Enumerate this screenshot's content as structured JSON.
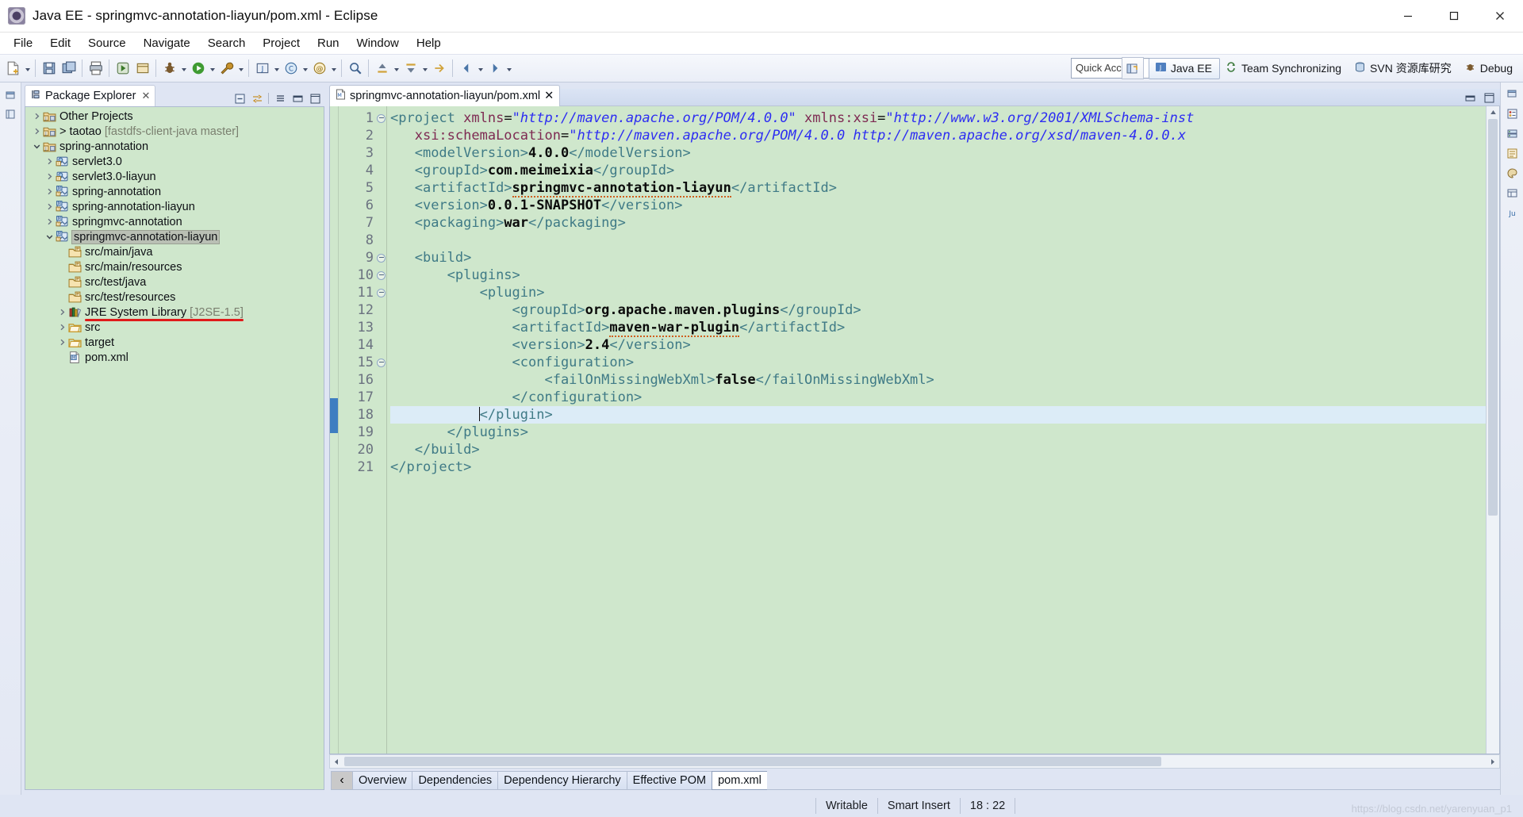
{
  "window": {
    "title": "Java EE - springmvc-annotation-liayun/pom.xml - Eclipse",
    "app_icon": "eclipse-icon",
    "minimize_label": "Minimize",
    "maximize_label": "Maximize",
    "close_label": "Close"
  },
  "menubar": {
    "items": [
      {
        "label": "File"
      },
      {
        "label": "Edit"
      },
      {
        "label": "Source"
      },
      {
        "label": "Navigate"
      },
      {
        "label": "Search"
      },
      {
        "label": "Project"
      },
      {
        "label": "Run"
      },
      {
        "label": "Window"
      },
      {
        "label": "Help"
      }
    ]
  },
  "toolbar": {
    "quick_access_placeholder": "Quick Access",
    "quick_access_value": "",
    "open_perspective_label": "Open Perspective",
    "perspectives": [
      {
        "label": "Java EE",
        "active": true,
        "icon": "java-ee-perspective-icon"
      },
      {
        "label": "Team Synchronizing",
        "active": false,
        "icon": "team-sync-icon"
      },
      {
        "label": "SVN 资源库研究",
        "active": false,
        "icon": "svn-repo-icon"
      },
      {
        "label": "Debug",
        "active": false,
        "icon": "debug-perspective-icon"
      }
    ]
  },
  "explorer": {
    "tab_label": "Package Explorer",
    "tab_close": "✕",
    "tools": [
      {
        "name": "collapse-all-icon"
      },
      {
        "name": "link-with-editor-icon"
      },
      {
        "name": "view-menu-icon"
      },
      {
        "name": "minimize-view-icon"
      },
      {
        "name": "maximize-view-icon"
      }
    ],
    "tree": [
      {
        "indent": 0,
        "twisty": "collapsed",
        "icon": "project-folder-icon",
        "label": "Other Projects",
        "suffix": "",
        "selected": false,
        "underline": false
      },
      {
        "indent": 0,
        "twisty": "collapsed",
        "icon": "project-folder-icon",
        "label": "> taotao",
        "suffix": "[fastdfs-client-java master]",
        "selected": false,
        "underline": false
      },
      {
        "indent": 0,
        "twisty": "expanded",
        "icon": "project-folder-icon",
        "label": "spring-annotation",
        "suffix": "",
        "selected": false,
        "underline": false
      },
      {
        "indent": 1,
        "twisty": "collapsed",
        "icon": "web-project-icon",
        "label": "servlet3.0",
        "suffix": "",
        "selected": false,
        "underline": false
      },
      {
        "indent": 1,
        "twisty": "collapsed",
        "icon": "web-project-icon",
        "label": "servlet3.0-liayun",
        "suffix": "",
        "selected": false,
        "underline": false
      },
      {
        "indent": 1,
        "twisty": "collapsed",
        "icon": "maven-project-icon",
        "label": "spring-annotation",
        "suffix": "",
        "selected": false,
        "underline": false
      },
      {
        "indent": 1,
        "twisty": "collapsed",
        "icon": "maven-project-icon",
        "label": "spring-annotation-liayun",
        "suffix": "",
        "selected": false,
        "underline": false
      },
      {
        "indent": 1,
        "twisty": "collapsed",
        "icon": "maven-project-icon",
        "label": "springmvc-annotation",
        "suffix": "",
        "selected": false,
        "underline": false
      },
      {
        "indent": 1,
        "twisty": "expanded",
        "icon": "maven-project-icon",
        "label": "springmvc-annotation-liayun",
        "suffix": "",
        "selected": true,
        "underline": false
      },
      {
        "indent": 2,
        "twisty": "none",
        "icon": "source-folder-icon",
        "label": "src/main/java",
        "suffix": "",
        "selected": false,
        "underline": false
      },
      {
        "indent": 2,
        "twisty": "none",
        "icon": "source-folder-icon",
        "label": "src/main/resources",
        "suffix": "",
        "selected": false,
        "underline": false
      },
      {
        "indent": 2,
        "twisty": "none",
        "icon": "source-folder-icon",
        "label": "src/test/java",
        "suffix": "",
        "selected": false,
        "underline": false
      },
      {
        "indent": 2,
        "twisty": "none",
        "icon": "source-folder-icon",
        "label": "src/test/resources",
        "suffix": "",
        "selected": false,
        "underline": false
      },
      {
        "indent": 2,
        "twisty": "collapsed",
        "icon": "library-icon",
        "label": "JRE System Library",
        "suffix": "[J2SE-1.5]",
        "selected": false,
        "underline": true
      },
      {
        "indent": 2,
        "twisty": "collapsed",
        "icon": "folder-icon",
        "label": "src",
        "suffix": "",
        "selected": false,
        "underline": false
      },
      {
        "indent": 2,
        "twisty": "collapsed",
        "icon": "folder-icon",
        "label": "target",
        "suffix": "",
        "selected": false,
        "underline": false
      },
      {
        "indent": 2,
        "twisty": "none",
        "icon": "pom-file-icon",
        "label": "pom.xml",
        "suffix": "",
        "selected": false,
        "underline": false
      }
    ]
  },
  "editor": {
    "tab_label": "springmvc-annotation-liayun/pom.xml",
    "tab_icon": "pom-file-icon",
    "tab_close": "✕",
    "highlight_line": 18,
    "lines": [
      {
        "n": 1,
        "fold": true,
        "tokens": [
          {
            "t": "tag",
            "v": "<project "
          },
          {
            "t": "attr",
            "v": "xmlns"
          },
          {
            "t": "eq",
            "v": "="
          },
          {
            "t": "val",
            "v": "\"http://maven.apache.org/POM/4.0.0\""
          },
          {
            "t": "eq",
            "v": " "
          },
          {
            "t": "attr",
            "v": "xmlns:xsi"
          },
          {
            "t": "eq",
            "v": "="
          },
          {
            "t": "val",
            "v": "\"http://www.w3.org/2001/XMLSchema-inst"
          }
        ]
      },
      {
        "n": 2,
        "fold": false,
        "tokens": [
          {
            "t": "eq",
            "v": "   "
          },
          {
            "t": "attr",
            "v": "xsi:schemaLocation"
          },
          {
            "t": "eq",
            "v": "="
          },
          {
            "t": "val",
            "v": "\"http://maven.apache.org/POM/4.0.0 http://maven.apache.org/xsd/maven-4.0.0.x"
          }
        ]
      },
      {
        "n": 3,
        "fold": false,
        "tokens": [
          {
            "t": "eq",
            "v": "   "
          },
          {
            "t": "tag",
            "v": "<modelVersion>"
          },
          {
            "t": "txt",
            "v": "4.0.0"
          },
          {
            "t": "tag",
            "v": "</modelVersion>"
          }
        ]
      },
      {
        "n": 4,
        "fold": false,
        "tokens": [
          {
            "t": "eq",
            "v": "   "
          },
          {
            "t": "tag",
            "v": "<groupId>"
          },
          {
            "t": "txt",
            "v": "com.meimeixia"
          },
          {
            "t": "tag",
            "v": "</groupId>"
          }
        ]
      },
      {
        "n": 5,
        "fold": false,
        "tokens": [
          {
            "t": "eq",
            "v": "   "
          },
          {
            "t": "tag",
            "v": "<artifactId>"
          },
          {
            "t": "squig",
            "v": "springmvc-annotation-liayun"
          },
          {
            "t": "tag",
            "v": "</artifactId>"
          }
        ]
      },
      {
        "n": 6,
        "fold": false,
        "tokens": [
          {
            "t": "eq",
            "v": "   "
          },
          {
            "t": "tag",
            "v": "<version>"
          },
          {
            "t": "txt",
            "v": "0.0.1-SNAPSHOT"
          },
          {
            "t": "tag",
            "v": "</version>"
          }
        ]
      },
      {
        "n": 7,
        "fold": false,
        "tokens": [
          {
            "t": "eq",
            "v": "   "
          },
          {
            "t": "tag",
            "v": "<packaging>"
          },
          {
            "t": "txt",
            "v": "war"
          },
          {
            "t": "tag",
            "v": "</packaging>"
          }
        ]
      },
      {
        "n": 8,
        "fold": false,
        "tokens": []
      },
      {
        "n": 9,
        "fold": true,
        "tokens": [
          {
            "t": "eq",
            "v": "   "
          },
          {
            "t": "tag",
            "v": "<build>"
          }
        ]
      },
      {
        "n": 10,
        "fold": true,
        "tokens": [
          {
            "t": "eq",
            "v": "       "
          },
          {
            "t": "tag",
            "v": "<plugins>"
          }
        ]
      },
      {
        "n": 11,
        "fold": true,
        "tokens": [
          {
            "t": "eq",
            "v": "           "
          },
          {
            "t": "tag",
            "v": "<plugin>"
          }
        ]
      },
      {
        "n": 12,
        "fold": false,
        "tokens": [
          {
            "t": "eq",
            "v": "               "
          },
          {
            "t": "tag",
            "v": "<groupId>"
          },
          {
            "t": "txt",
            "v": "org.apache.maven.plugins"
          },
          {
            "t": "tag",
            "v": "</groupId>"
          }
        ]
      },
      {
        "n": 13,
        "fold": false,
        "tokens": [
          {
            "t": "eq",
            "v": "               "
          },
          {
            "t": "tag",
            "v": "<artifactId>"
          },
          {
            "t": "squig",
            "v": "maven-war-plugin"
          },
          {
            "t": "tag",
            "v": "</artifactId>"
          }
        ]
      },
      {
        "n": 14,
        "fold": false,
        "tokens": [
          {
            "t": "eq",
            "v": "               "
          },
          {
            "t": "tag",
            "v": "<version>"
          },
          {
            "t": "txt",
            "v": "2.4"
          },
          {
            "t": "tag",
            "v": "</version>"
          }
        ]
      },
      {
        "n": 15,
        "fold": true,
        "tokens": [
          {
            "t": "eq",
            "v": "               "
          },
          {
            "t": "tag",
            "v": "<configuration>"
          }
        ]
      },
      {
        "n": 16,
        "fold": false,
        "tokens": [
          {
            "t": "eq",
            "v": "                   "
          },
          {
            "t": "tag",
            "v": "<failOnMissingWebXml>"
          },
          {
            "t": "txt",
            "v": "false"
          },
          {
            "t": "tag",
            "v": "</failOnMissingWebXml>"
          }
        ]
      },
      {
        "n": 17,
        "fold": false,
        "tokens": [
          {
            "t": "eq",
            "v": "               "
          },
          {
            "t": "tag",
            "v": "</configuration>"
          }
        ]
      },
      {
        "n": 18,
        "fold": false,
        "tokens": [
          {
            "t": "eq",
            "v": "           "
          },
          {
            "t": "tag",
            "v": "</plugin>"
          }
        ]
      },
      {
        "n": 19,
        "fold": false,
        "tokens": [
          {
            "t": "eq",
            "v": "       "
          },
          {
            "t": "tag",
            "v": "</plugins>"
          }
        ]
      },
      {
        "n": 20,
        "fold": false,
        "tokens": [
          {
            "t": "eq",
            "v": "   "
          },
          {
            "t": "tag",
            "v": "</build>"
          }
        ]
      },
      {
        "n": 21,
        "fold": false,
        "tokens": [
          {
            "t": "tag",
            "v": "</project>"
          }
        ]
      }
    ],
    "bottom_tabs": [
      {
        "label": "Overview",
        "active": false
      },
      {
        "label": "Dependencies",
        "active": false
      },
      {
        "label": "Dependency Hierarchy",
        "active": false
      },
      {
        "label": "Effective POM",
        "active": false
      },
      {
        "label": "pom.xml",
        "active": true
      }
    ],
    "prev_tab_glyph": "‹"
  },
  "statusbar": {
    "writable": "Writable",
    "insert_mode": "Smart Insert",
    "position": "18 : 22",
    "watermark": "https://blog.csdn.net/yarenyuan_p1"
  },
  "colors": {
    "tree_bg": "#cfe7cc",
    "editor_bg": "#cfe7cc",
    "selection": "#b9bfb4",
    "underline_red": "#e01b1b",
    "tag": "#3f7a86",
    "attr": "#7e2a52",
    "value": "#2d2df2",
    "text": "#0b0b0b",
    "chrome": "#dfe5f3"
  }
}
